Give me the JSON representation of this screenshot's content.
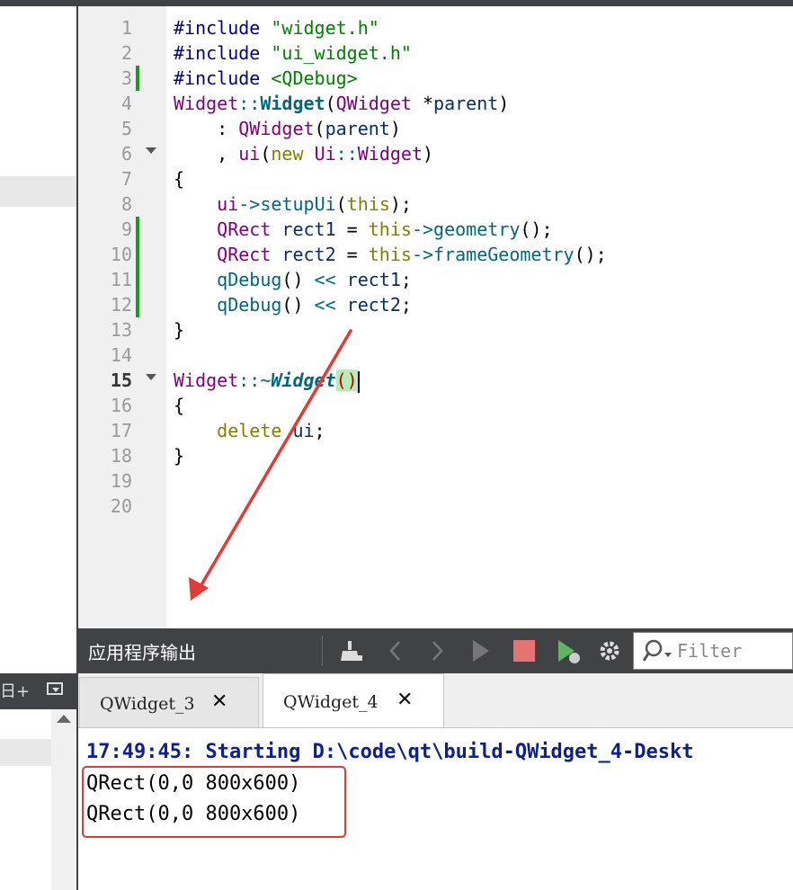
{
  "editor": {
    "line_numbers": [
      "1",
      "2",
      "3",
      "4",
      "5",
      "6",
      "7",
      "8",
      "9",
      "10",
      "11",
      "12",
      "13",
      "14",
      "15",
      "16",
      "17",
      "18",
      "19",
      "20"
    ],
    "code": {
      "l1_pp": "#include",
      "l1_str": "\"widget.h\"",
      "l2_pp": "#include",
      "l2_str": "\"ui_widget.h\"",
      "l3_pp": "#include",
      "l3_str": "<QDebug>",
      "l4_cls": "Widget",
      "l4_op": "::",
      "l4_fn": "Widget",
      "l4_open": "(",
      "l4_cls2": "QWidget",
      "l4_ptr": " *",
      "l4_var": "parent",
      "l4_close": ")",
      "l5_colon": "    : ",
      "l5_cls": "QWidget",
      "l5_open": "(",
      "l5_var": "parent",
      "l5_close": ")",
      "l6_comma": "    , ",
      "l6_var": "ui",
      "l6_open": "(",
      "l6_kw": "new",
      "l6_sp": " ",
      "l6_cls": "Ui",
      "l6_op": "::",
      "l6_cls2": "Widget",
      "l6_close": ")",
      "l7": "{",
      "l8_indent": "    ",
      "l8_var": "ui",
      "l8_op": "->",
      "l8_fn": "setupUi",
      "l8_open": "(",
      "l8_kw": "this",
      "l8_close": ");",
      "l9_indent": "    ",
      "l9_cls": "QRect",
      "l9_var": " rect1",
      "l9_eq": " = ",
      "l9_kw": "this",
      "l9_op": "->",
      "l9_fn": "geometry",
      "l9_close": "();",
      "l10_indent": "    ",
      "l10_cls": "QRect",
      "l10_var": " rect2",
      "l10_eq": " = ",
      "l10_kw": "this",
      "l10_op": "->",
      "l10_fn": "frameGeometry",
      "l10_close": "();",
      "l11_indent": "    ",
      "l11_fn": "qDebug",
      "l11_paren": "() ",
      "l11_op": "<<",
      "l11_var": " rect1",
      "l11_end": ";",
      "l12_indent": "    ",
      "l12_fn": "qDebug",
      "l12_paren": "() ",
      "l12_op": "<<",
      "l12_var": " rect2",
      "l12_end": ";",
      "l13": "}",
      "l15_cls": "Widget",
      "l15_op": "::~",
      "l15_fn": "Widget",
      "l15_paren": "()",
      "l16": "{",
      "l17_indent": "    ",
      "l17_kw": "delete",
      "l17_var": " ui",
      "l17_end": ";",
      "l18": "}"
    }
  },
  "output_panel": {
    "title": "应用程序输出",
    "toolbar_icons": [
      "clean-icon",
      "prev-icon",
      "next-icon",
      "run-icon",
      "stop-icon",
      "debug-run-icon",
      "gear-icon"
    ],
    "filter_placeholder": "Filter",
    "tabs": [
      {
        "label": "QWidget_3",
        "active": false
      },
      {
        "label": "QWidget_4",
        "active": true
      }
    ],
    "lines": [
      "17:49:45: Starting D:\\code\\qt\\build-QWidget_4-Deskt",
      "QRect(0,0 800x600)",
      "QRect(0,0 800x600)"
    ]
  },
  "left_panel": {
    "split_icon": "日+"
  },
  "colors": {
    "dark_chrome": "#404244",
    "gutter": "#f0f0f0",
    "change_bar": "#1a9b1a",
    "annotation_red": "#e53935",
    "output_start": "#0c2090"
  }
}
